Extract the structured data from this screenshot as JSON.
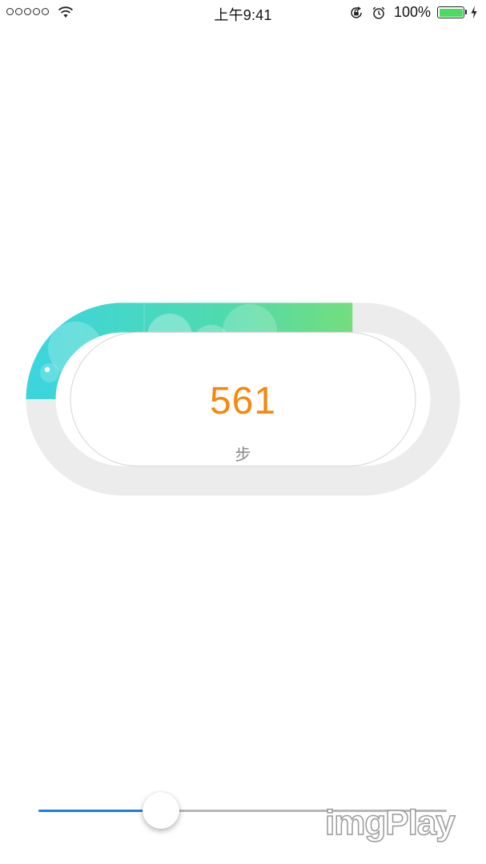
{
  "status_bar": {
    "time": "上午9:41",
    "battery_percent": "100%",
    "battery_level": 1.0,
    "icons": [
      "signal-dots-icon",
      "wifi-icon",
      "rotation-lock-icon",
      "alarm-icon",
      "battery-icon",
      "charging-bolt-icon"
    ]
  },
  "progress_ring": {
    "value": "561",
    "unit": "步",
    "progress_fraction": 0.36,
    "colors": {
      "track": "#ececec",
      "gradient_start": "#3dd5dc",
      "gradient_mid": "#4fdaae",
      "gradient_end": "#8fe05a",
      "value_text": "#f5880f",
      "unit_text": "#888888"
    }
  },
  "slider": {
    "value_fraction": 0.3,
    "colors": {
      "filled": "#1a7ee8",
      "empty": "#b6b6b6"
    }
  },
  "watermark": {
    "text": "imgPlay"
  }
}
